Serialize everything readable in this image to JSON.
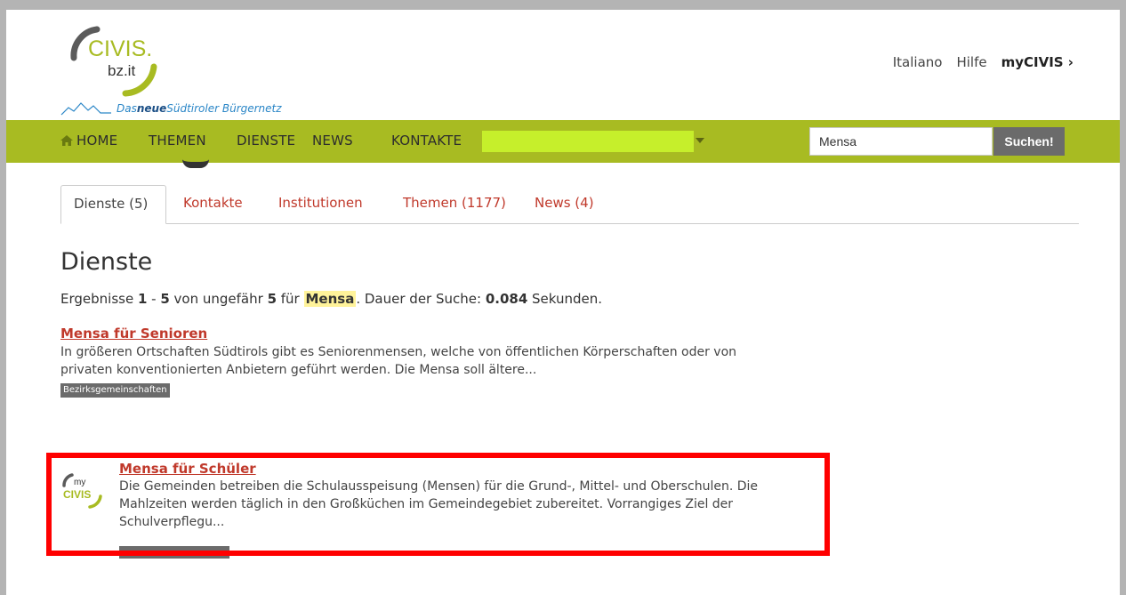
{
  "header": {
    "logo_text": "CIVIS.",
    "logo_sub": "bz.it",
    "tagline_pre": "Das ",
    "tagline_bold": "neue",
    "tagline_post": " Südtiroler Bürgernetz",
    "links": {
      "italiano": "Italiano",
      "hilfe": "Hilfe",
      "mycivis": "myCIVIS ›"
    }
  },
  "nav": {
    "home": "HOME",
    "themen": "THEMEN",
    "dienste": "DIENSTE",
    "news": "NEWS",
    "kontakte": "KONTAKTE"
  },
  "search": {
    "value": "Mensa",
    "button": "Suchen!"
  },
  "tabs": [
    {
      "label": "Dienste (5)"
    },
    {
      "label": "Kontakte"
    },
    {
      "label": "Institutionen"
    },
    {
      "label": "Themen (1177)"
    },
    {
      "label": "News (4)"
    }
  ],
  "section": {
    "title": "Dienste",
    "summary": {
      "pre": "Ergebnisse ",
      "from": "1",
      "dash": " - ",
      "to": "5",
      "mid1": " von ungefähr ",
      "count": "5",
      "mid2": " für ",
      "query": "Mensa",
      "mid3": ". Dauer der Suche: ",
      "duration": "0.084",
      "post": " Sekunden."
    }
  },
  "results": [
    {
      "title": "Mensa für Senioren",
      "text": "In größeren Ortschaften Südtirols gibt es Seniorenmensen, welche von öffentlichen Körperschaften oder von privaten konventionierten Anbietern geführt werden. Die Mensa soll ältere...",
      "tag": "Bezirksgemeinschaften"
    },
    {
      "badge_my": "my",
      "badge_civis": "CIVIS",
      "title": "Mensa für Schüler",
      "text": "Die Gemeinden betreiben die Schulausspeisung (Mensen) für die Grund-, Mittel- und Oberschulen. Die Mahlzeiten werden täglich in den Großküchen im Gemeindegebiet zubereitet. Vorrangiges Ziel der Schulverpflegu..."
    }
  ],
  "colors": {
    "nav_green": "#a8bb22",
    "link_red": "#c0392b",
    "highlight_red": "#ff0000",
    "tag_gray": "#6b6b6b"
  }
}
